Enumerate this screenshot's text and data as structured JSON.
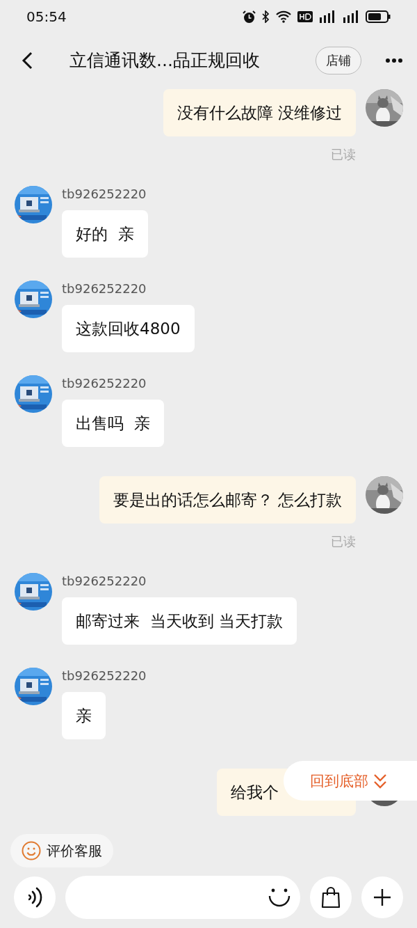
{
  "status_bar": {
    "time": "05:54"
  },
  "header": {
    "title": "立信通讯数...品正规回收",
    "shop_button": "店铺"
  },
  "messages": [
    {
      "kind": "outgoing",
      "text": "没有什么故障 没维修过",
      "read_label": "已读"
    },
    {
      "kind": "incoming",
      "sender": "tb926252220",
      "text": "好的  亲"
    },
    {
      "kind": "incoming",
      "sender": "tb926252220",
      "text": "这款回收4800"
    },
    {
      "kind": "incoming",
      "sender": "tb926252220",
      "text": "出售吗  亲"
    },
    {
      "kind": "outgoing",
      "text": "要是出的话怎么邮寄？ 怎么打款",
      "read_label": "已读"
    },
    {
      "kind": "incoming",
      "sender": "tb926252220",
      "text": "邮寄过来  当天收到 当天打款"
    },
    {
      "kind": "incoming",
      "sender": "tb926252220",
      "text": "亲"
    },
    {
      "kind": "outgoing",
      "text": "给我个",
      "obscured": true
    }
  ],
  "scroll_to_bottom": {
    "label": "回到底部"
  },
  "rate_service": {
    "label": "评价客服"
  }
}
